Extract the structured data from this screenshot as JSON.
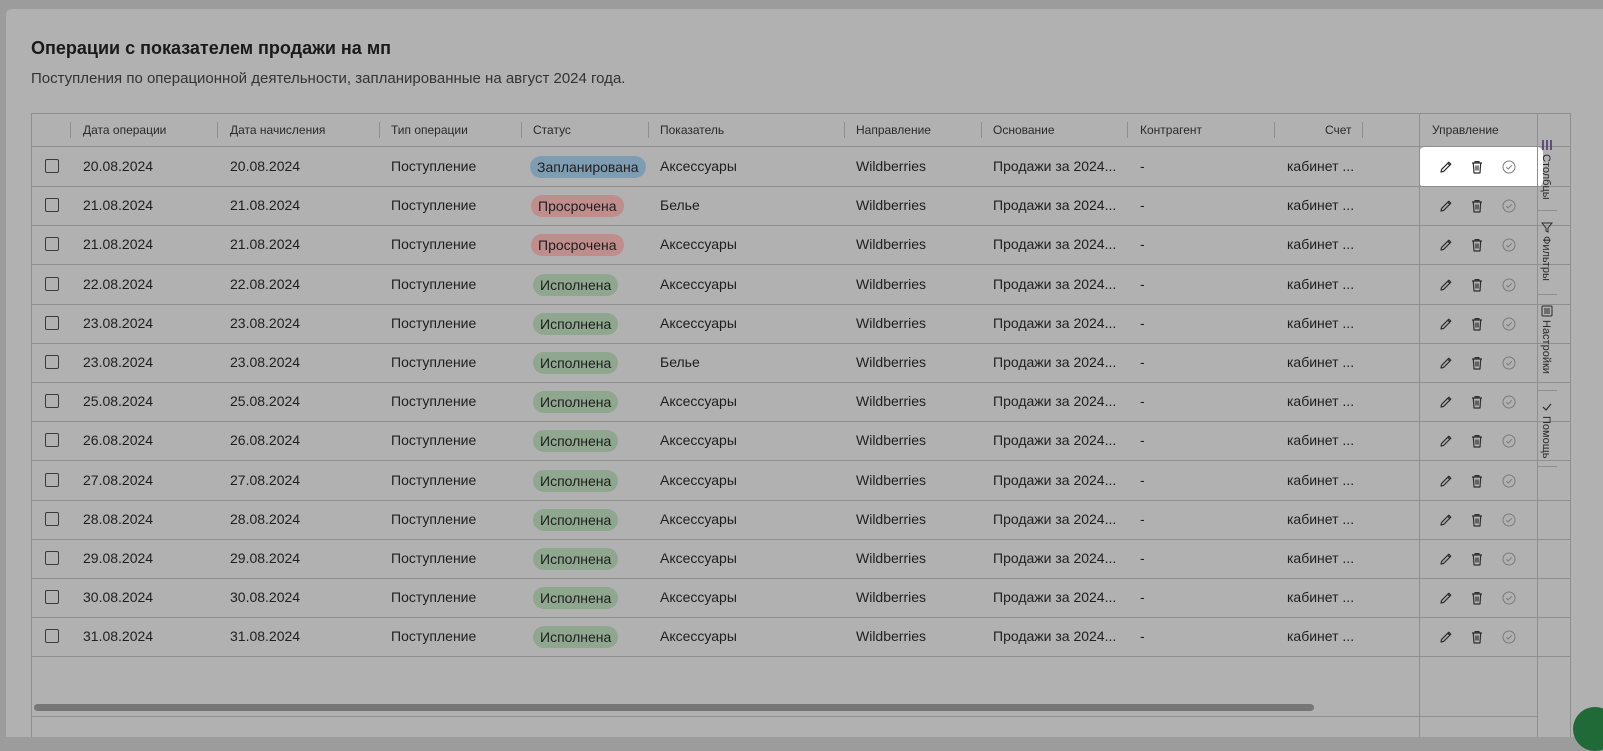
{
  "page": {
    "title": "Операции с показателем продажи на мп",
    "subtitle": "Поступления по операционной деятельности, запланированные на август 2024 года."
  },
  "columns": {
    "date_op": "Дата операции",
    "date_acc": "Дата начисления",
    "op_type": "Тип операции",
    "status": "Статус",
    "indicator": "Показатель",
    "direction": "Направление",
    "basis": "Основание",
    "counterparty": "Контрагент",
    "account": "Счет",
    "control": "Управление"
  },
  "rows": [
    {
      "date_op": "20.08.2024",
      "date_acc": "20.08.2024",
      "op_type": "Поступление",
      "status": "Запланирована",
      "status_kind": "planned",
      "indicator": "Аксессуары",
      "direction": "Wildberries",
      "basis": "Продажи за 2024...",
      "counterparty": "-",
      "account": "кабинет ..."
    },
    {
      "date_op": "21.08.2024",
      "date_acc": "21.08.2024",
      "op_type": "Поступление",
      "status": "Просрочена",
      "status_kind": "overdue",
      "indicator": "Белье",
      "direction": "Wildberries",
      "basis": "Продажи за 2024...",
      "counterparty": "-",
      "account": "кабинет ..."
    },
    {
      "date_op": "21.08.2024",
      "date_acc": "21.08.2024",
      "op_type": "Поступление",
      "status": "Просрочена",
      "status_kind": "overdue",
      "indicator": "Аксессуары",
      "direction": "Wildberries",
      "basis": "Продажи за 2024...",
      "counterparty": "-",
      "account": "кабинет ..."
    },
    {
      "date_op": "22.08.2024",
      "date_acc": "22.08.2024",
      "op_type": "Поступление",
      "status": "Исполнена",
      "status_kind": "done",
      "indicator": "Аксессуары",
      "direction": "Wildberries",
      "basis": "Продажи за 2024...",
      "counterparty": "-",
      "account": "кабинет ..."
    },
    {
      "date_op": "23.08.2024",
      "date_acc": "23.08.2024",
      "op_type": "Поступление",
      "status": "Исполнена",
      "status_kind": "done",
      "indicator": "Аксессуары",
      "direction": "Wildberries",
      "basis": "Продажи за 2024...",
      "counterparty": "-",
      "account": "кабинет ..."
    },
    {
      "date_op": "23.08.2024",
      "date_acc": "23.08.2024",
      "op_type": "Поступление",
      "status": "Исполнена",
      "status_kind": "done",
      "indicator": "Белье",
      "direction": "Wildberries",
      "basis": "Продажи за 2024...",
      "counterparty": "-",
      "account": "кабинет ..."
    },
    {
      "date_op": "25.08.2024",
      "date_acc": "25.08.2024",
      "op_type": "Поступление",
      "status": "Исполнена",
      "status_kind": "done",
      "indicator": "Аксессуары",
      "direction": "Wildberries",
      "basis": "Продажи за 2024...",
      "counterparty": "-",
      "account": "кабинет ..."
    },
    {
      "date_op": "26.08.2024",
      "date_acc": "26.08.2024",
      "op_type": "Поступление",
      "status": "Исполнена",
      "status_kind": "done",
      "indicator": "Аксессуары",
      "direction": "Wildberries",
      "basis": "Продажи за 2024...",
      "counterparty": "-",
      "account": "кабинет ..."
    },
    {
      "date_op": "27.08.2024",
      "date_acc": "27.08.2024",
      "op_type": "Поступление",
      "status": "Исполнена",
      "status_kind": "done",
      "indicator": "Аксессуары",
      "direction": "Wildberries",
      "basis": "Продажи за 2024...",
      "counterparty": "-",
      "account": "кабинет ..."
    },
    {
      "date_op": "28.08.2024",
      "date_acc": "28.08.2024",
      "op_type": "Поступление",
      "status": "Исполнена",
      "status_kind": "done",
      "indicator": "Аксессуары",
      "direction": "Wildberries",
      "basis": "Продажи за 2024...",
      "counterparty": "-",
      "account": "кабинет ..."
    },
    {
      "date_op": "29.08.2024",
      "date_acc": "29.08.2024",
      "op_type": "Поступление",
      "status": "Исполнена",
      "status_kind": "done",
      "indicator": "Аксессуары",
      "direction": "Wildberries",
      "basis": "Продажи за 2024...",
      "counterparty": "-",
      "account": "кабинет ..."
    },
    {
      "date_op": "30.08.2024",
      "date_acc": "30.08.2024",
      "op_type": "Поступление",
      "status": "Исполнена",
      "status_kind": "done",
      "indicator": "Аксессуары",
      "direction": "Wildberries",
      "basis": "Продажи за 2024...",
      "counterparty": "-",
      "account": "кабинет ..."
    },
    {
      "date_op": "31.08.2024",
      "date_acc": "31.08.2024",
      "op_type": "Поступление",
      "status": "Исполнена",
      "status_kind": "done",
      "indicator": "Аксессуары",
      "direction": "Wildberries",
      "basis": "Продажи за 2024...",
      "counterparty": "-",
      "account": "кабинет ..."
    }
  ],
  "sidebar": {
    "columns": "Столбцы",
    "filters": "Фильтры",
    "settings": "Настройки",
    "help": "Помощь"
  },
  "icons": {
    "edit": "pencil-icon",
    "delete": "trash-icon",
    "confirm": "check-circle-icon"
  },
  "colors": {
    "planned": "#7f9db2",
    "overdue": "#c08d8d",
    "done": "#8ea78e",
    "fab": "#1f6a37"
  }
}
